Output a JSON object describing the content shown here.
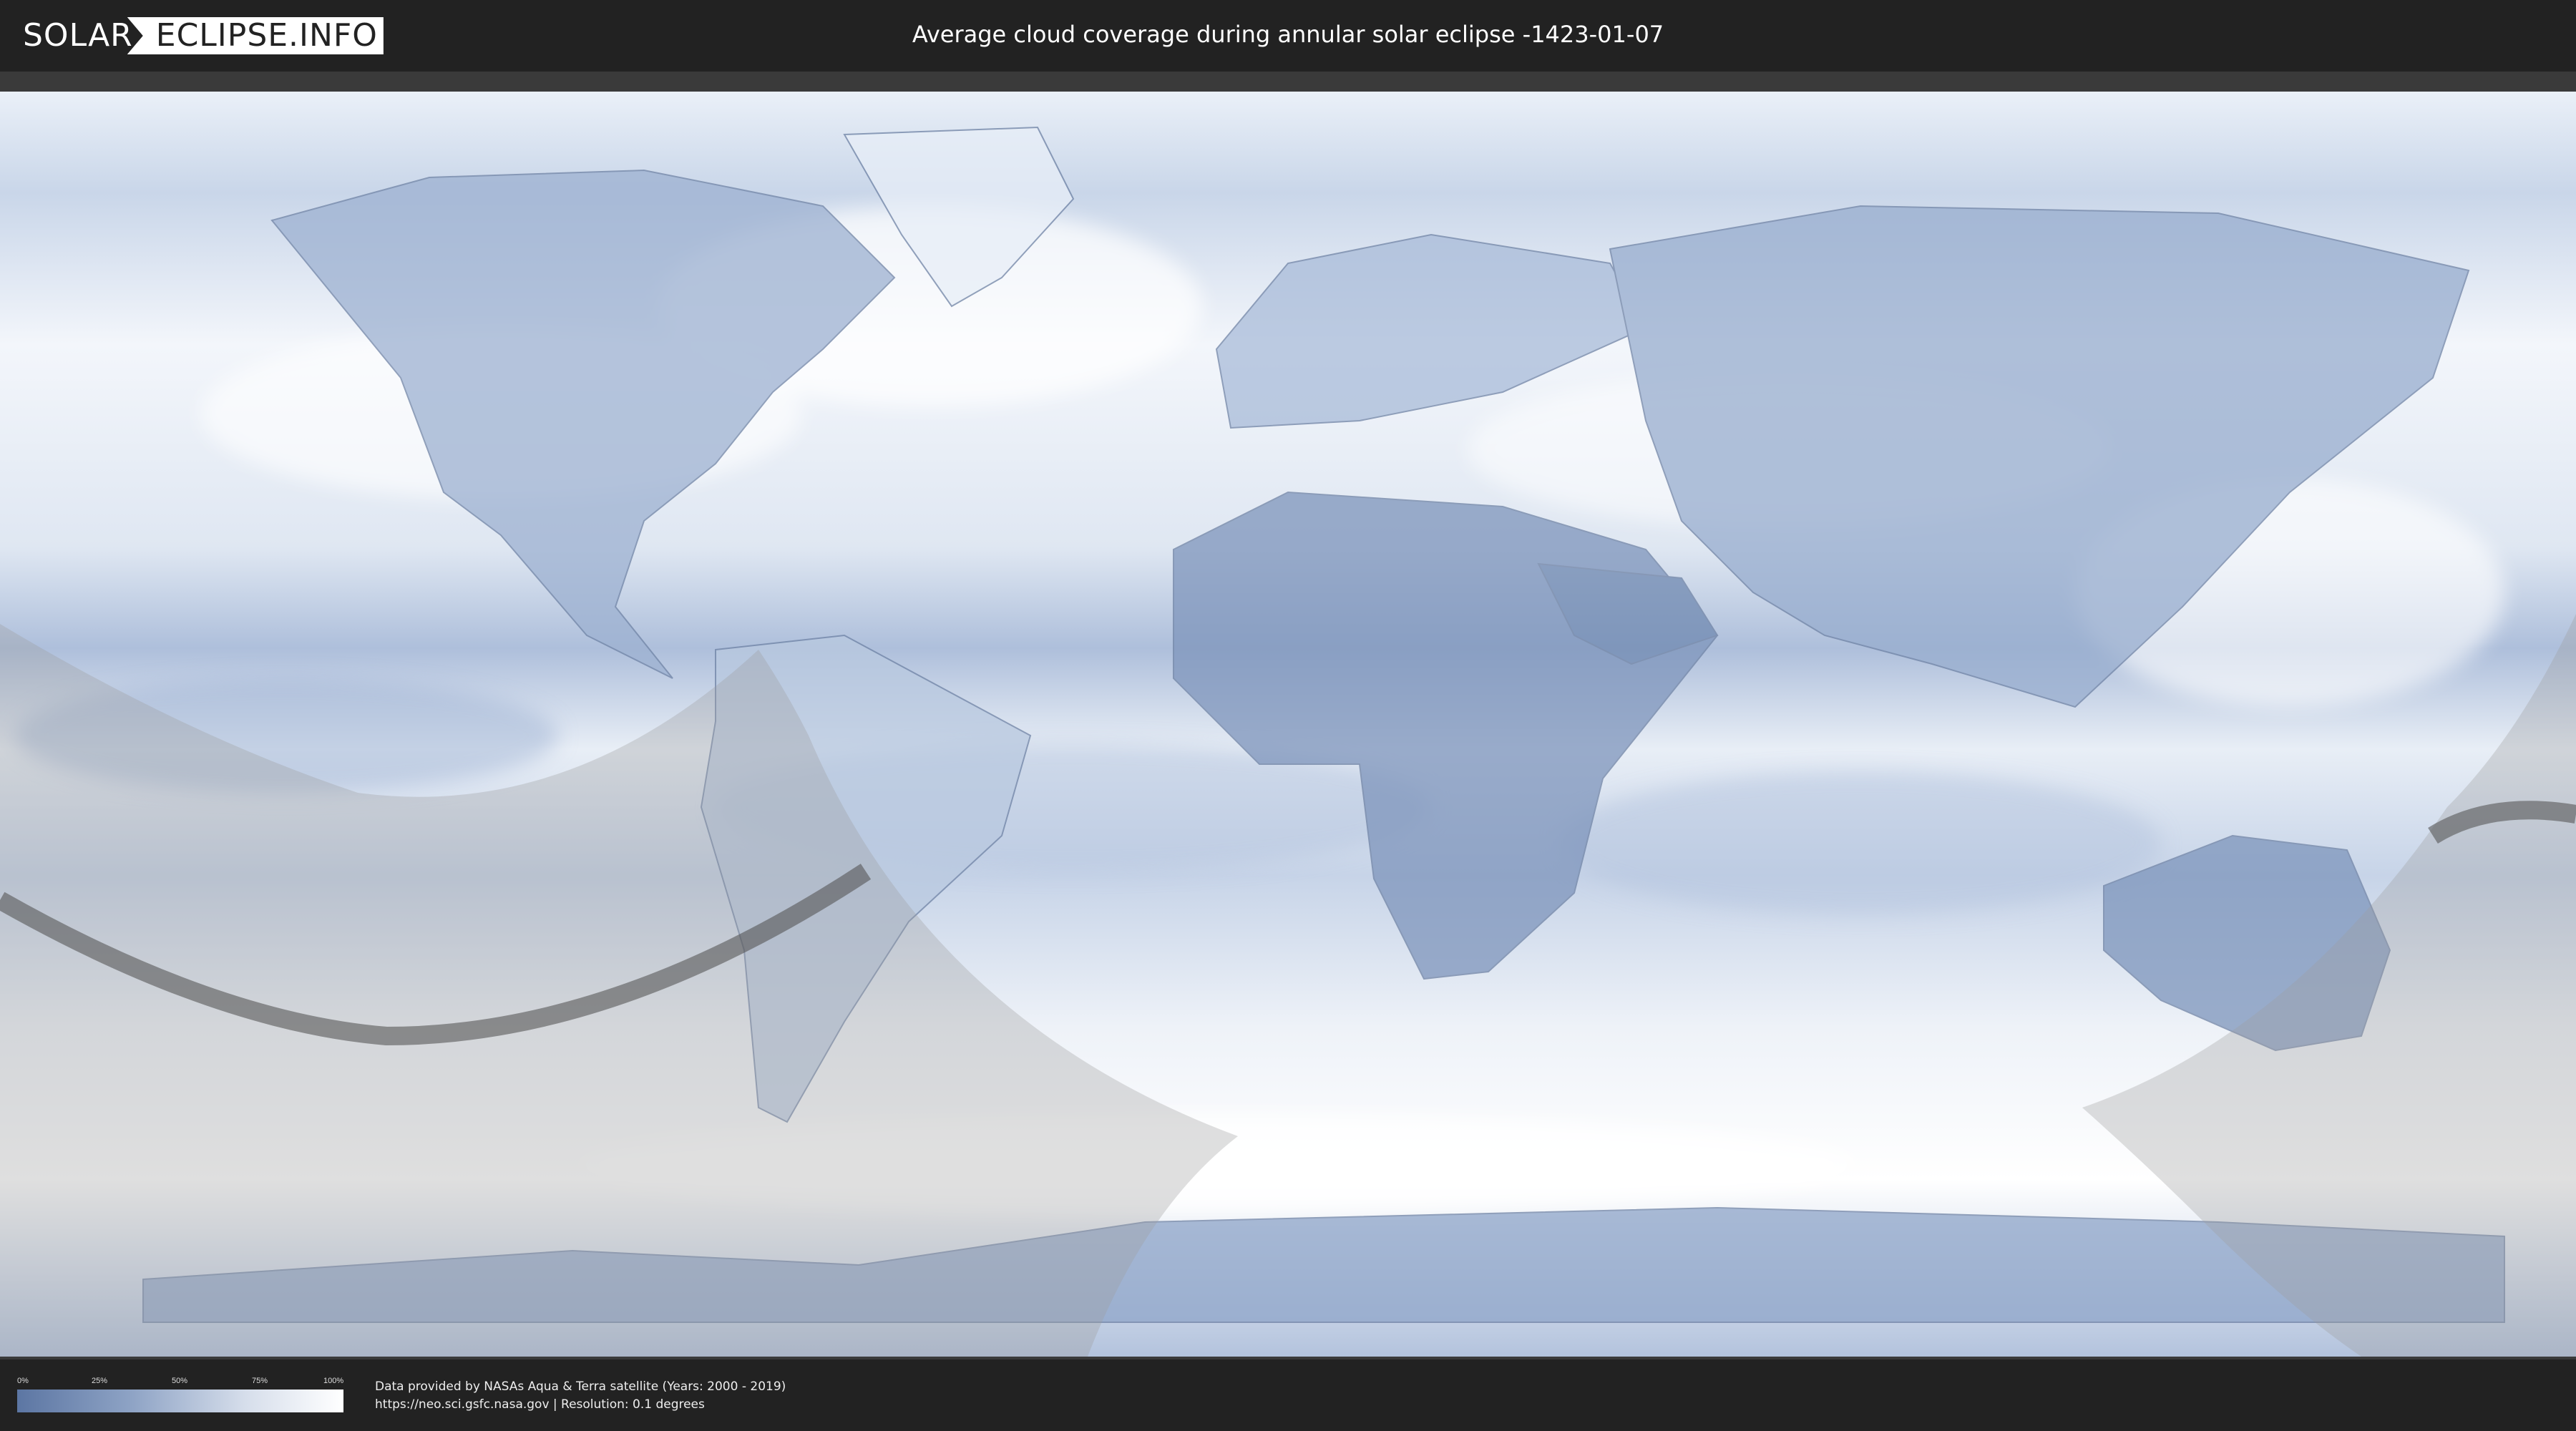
{
  "header": {
    "logo_left": "SOLAR",
    "logo_right": "ECLIPSE.INFO",
    "title": "Average cloud coverage during annular solar eclipse -1423-01-07"
  },
  "legend": {
    "ticks": [
      "0%",
      "25%",
      "50%",
      "75%",
      "100%"
    ],
    "colors": {
      "low": "#5c76a3",
      "high": "#ffffff"
    }
  },
  "footer": {
    "credit_line1": "Data provided by NASAs Aqua & Terra satellite (Years: 2000 - 2019)",
    "credit_line2": "https://neo.sci.gsfc.nasa.gov | Resolution: 0.1 degrees"
  },
  "colors": {
    "background": "#222222",
    "cloud_light": "#f4f7fb",
    "cloud_dark": "#7d94bb",
    "shadow_zone": "#9a9a9a",
    "central_path": "#555555"
  }
}
